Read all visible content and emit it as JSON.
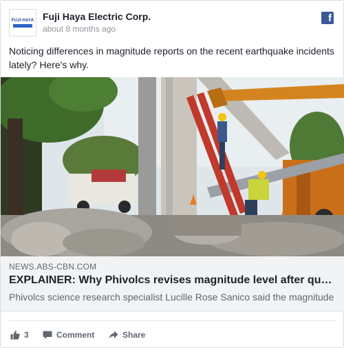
{
  "post": {
    "page_name": "Fuji Haya Electric Corp.",
    "timestamp": "about 8 months ago",
    "avatar_logo_text": "FUJI-HAYA",
    "message": "Noticing differences in magnitude reports on the recent earthquake incidents lately? Here's why."
  },
  "link": {
    "domain": "NEWS.ABS-CBN.COM",
    "title": "EXPLAINER: Why Phivolcs revises magnitude level after quake",
    "description": "Phivolcs science research specialist Lucille Rose Sanico said the magnitude"
  },
  "actions": {
    "like_count": "3",
    "comment_label": "Comment",
    "share_label": "Share"
  },
  "icons": {
    "brand": "facebook-icon",
    "like": "thumbs-up-icon",
    "comment": "speech-bubble-icon",
    "share": "share-arrow-icon"
  },
  "colors": {
    "facebook_blue": "#3b5998",
    "text_primary": "#1d2129",
    "text_secondary": "#606770",
    "link_background": "#f2f3f5"
  }
}
